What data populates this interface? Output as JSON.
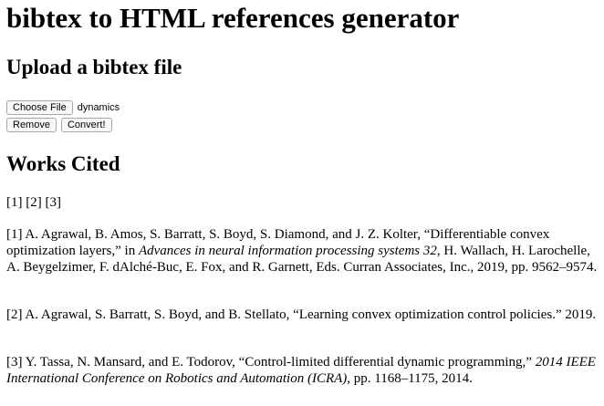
{
  "page": {
    "title": "bibtex to HTML references generator",
    "upload_heading": "Upload a bibtex file",
    "choose_file_label": "Choose File",
    "selected_file": "dynamics",
    "remove_label": "Remove",
    "convert_label": "Convert!",
    "works_heading": "Works Cited"
  },
  "citations": [
    "[1]",
    "[2]",
    "[3]"
  ],
  "references": [
    {
      "prefix": "[1] A. Agrawal, B. Amos, S. Barratt, S. Boyd, S. Diamond, and J. Z. Kolter, “Differentiable convex optimization layers,” in ",
      "italic": "Advances in neural information processing systems 32",
      "suffix": ", H. Wallach, H. Larochelle, A. Beygelzimer, F. dAlché-Buc, E. Fox, and R. Garnett, Eds. Curran Associates, Inc., 2019, pp. 9562–9574."
    },
    {
      "prefix": "[2] A. Agrawal, S. Barratt, S. Boyd, and B. Stellato, “Learning convex optimization control policies.” 2019.",
      "italic": "",
      "suffix": ""
    },
    {
      "prefix": "[3] Y. Tassa, N. Mansard, and E. Todorov, “Control-limited differential dynamic programming,” ",
      "italic": "2014 IEEE International Conference on Robotics and Automation (ICRA)",
      "suffix": ", pp. 1168–1175, 2014."
    }
  ]
}
